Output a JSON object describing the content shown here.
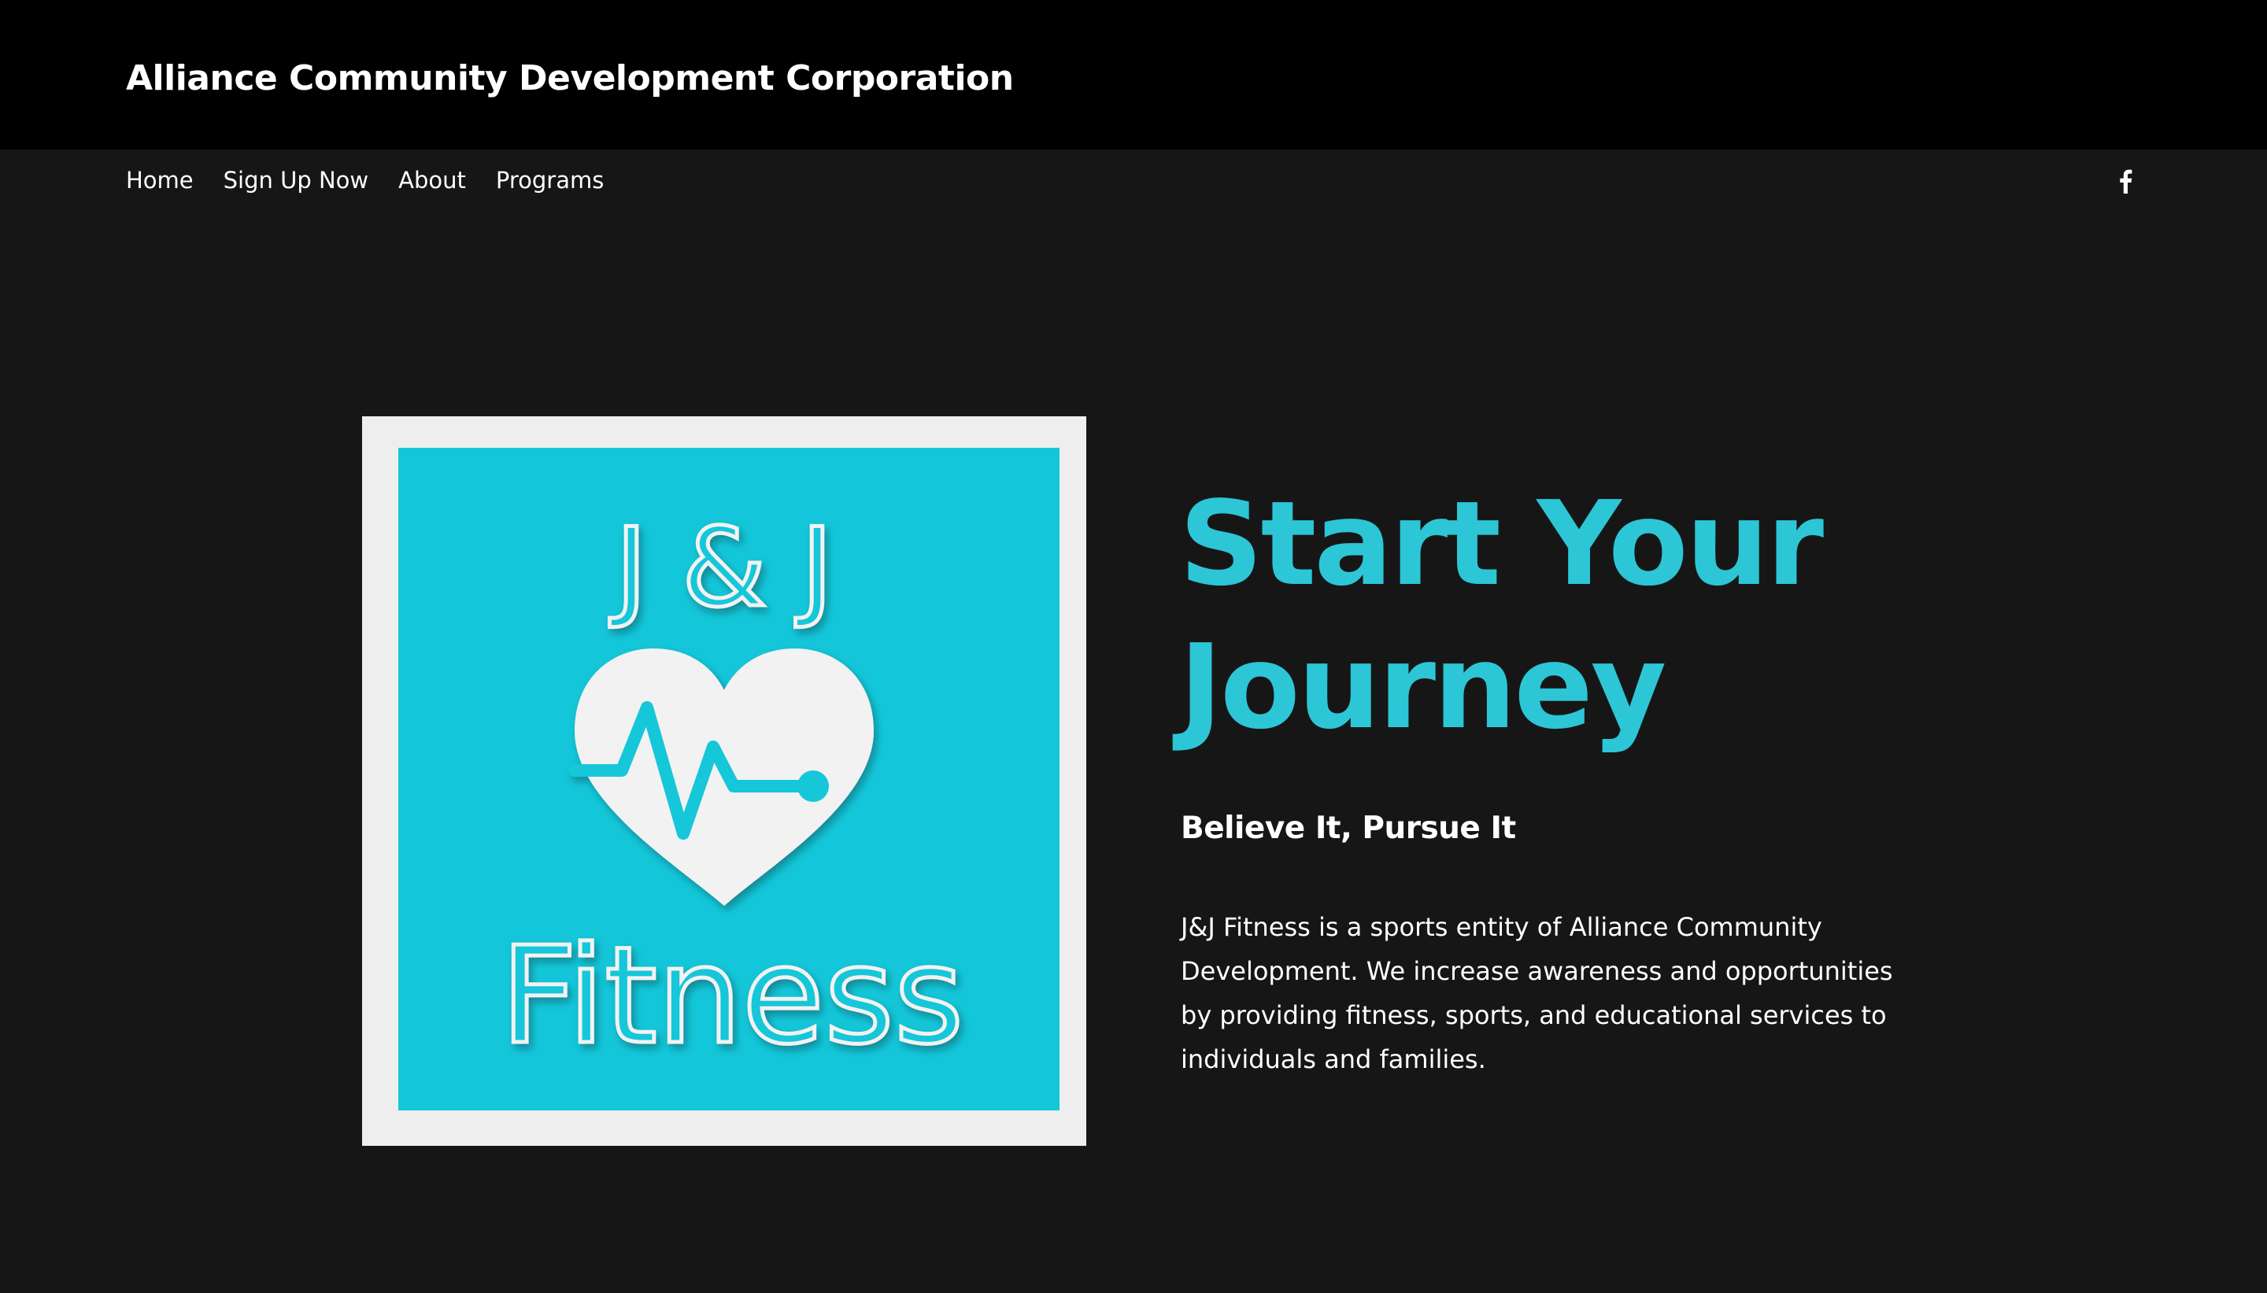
{
  "header": {
    "site_title": "Alliance Community Development Corporation"
  },
  "nav": {
    "links": [
      "Home",
      "Sign Up Now",
      "About",
      "Programs"
    ],
    "social_icon": "facebook-icon"
  },
  "hero": {
    "logo_text": {
      "top": "J & J",
      "bottom": "Fitness"
    },
    "logo_icon": "heart-pulse-icon",
    "title_line1": "Start Your",
    "title_line2": "Journey",
    "subtitle": "Believe It, Pursue It",
    "body": "J&J Fitness is a sports entity of Alliance Community Development. We increase awareness and opportunities by providing fitness, sports, and educational services to individuals and families."
  },
  "colors": {
    "accent": "#2cc6d6",
    "logo_teal": "#14c6d9",
    "header_bg": "#000000",
    "page_bg": "#161616",
    "text": "#ffffff"
  }
}
